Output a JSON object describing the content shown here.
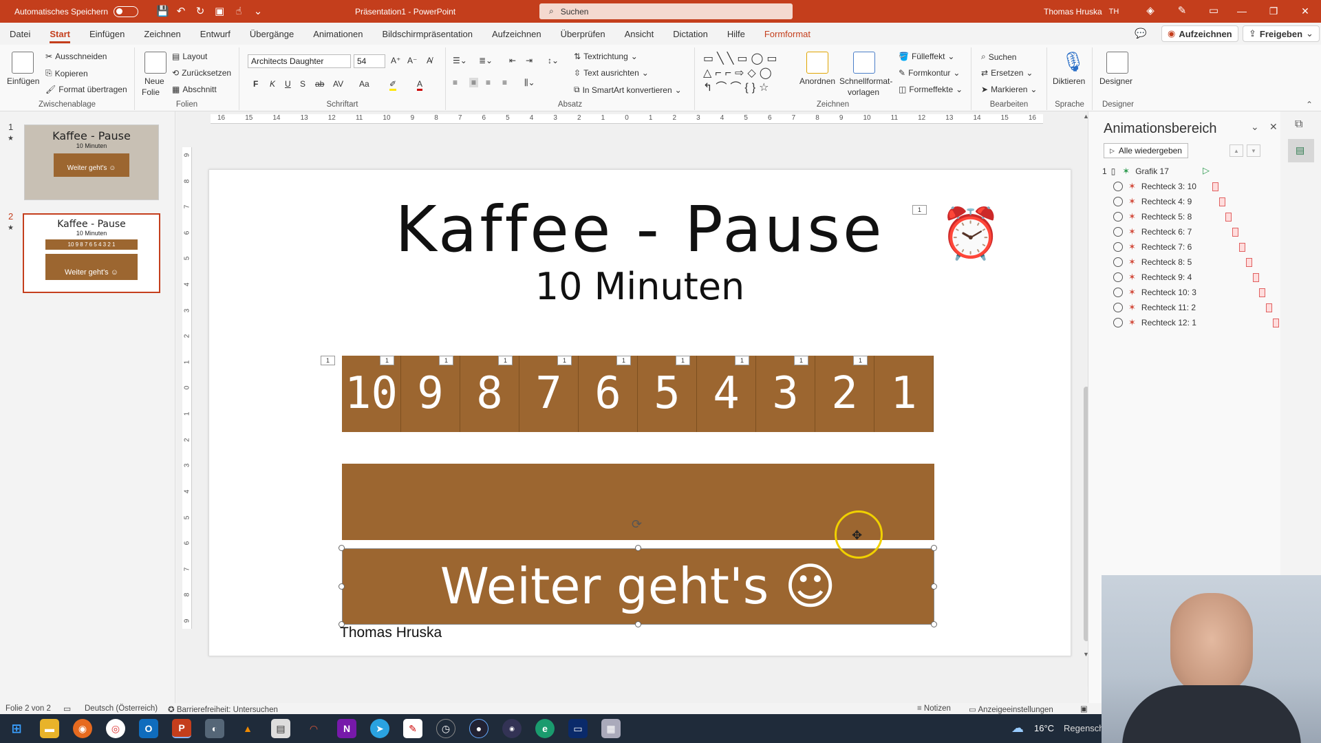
{
  "titlebar": {
    "autosave_label": "Automatisches Speichern",
    "doc_title": "Präsentation1 - PowerPoint",
    "search_placeholder": "Suchen",
    "user_name": "Thomas Hruska",
    "user_initials": "TH"
  },
  "tabs": [
    "Datei",
    "Start",
    "Einfügen",
    "Zeichnen",
    "Entwurf",
    "Übergänge",
    "Animationen",
    "Bildschirmpräsentation",
    "Aufzeichnen",
    "Überprüfen",
    "Ansicht",
    "Dictation",
    "Hilfe",
    "Formformat"
  ],
  "tab_actions": {
    "record": "Aufzeichnen",
    "share": "Freigeben"
  },
  "ribbon": {
    "clipboard": {
      "label": "Zwischenablage",
      "paste": "Einfügen",
      "cut": "Ausschneiden",
      "copy": "Kopieren",
      "format_painter": "Format übertragen"
    },
    "slides": {
      "label": "Folien",
      "new_slide_1": "Neue",
      "new_slide_2": "Folie",
      "layout": "Layout",
      "reset": "Zurücksetzen",
      "section": "Abschnitt"
    },
    "font": {
      "label": "Schriftart",
      "font_name": "Architects Daughter",
      "font_size": "54",
      "bold": "F",
      "italic": "K",
      "underline": "U",
      "shadow": "S",
      "strike": "ab",
      "spacing": "AV",
      "case": "Aa"
    },
    "paragraph": {
      "label": "Absatz",
      "text_direction": "Textrichtung",
      "align_text": "Text ausrichten",
      "smartart": "In SmartArt konvertieren"
    },
    "drawing": {
      "label": "Zeichnen",
      "arrange": "Anordnen",
      "quickstyles_1": "Schnellformat-",
      "quickstyles_2": "vorlagen",
      "fill": "Fülleffekt",
      "outline": "Formkontur",
      "effects": "Formeffekte"
    },
    "editing": {
      "label": "Bearbeiten",
      "find": "Suchen",
      "replace": "Ersetzen",
      "select": "Markieren"
    },
    "voice": {
      "label": "Sprache",
      "dictate": "Diktieren"
    },
    "designer": {
      "label": "Designer",
      "designer": "Designer"
    }
  },
  "ruler_h": [
    "16",
    "15",
    "14",
    "13",
    "12",
    "11",
    "10",
    "9",
    "8",
    "7",
    "6",
    "5",
    "4",
    "3",
    "2",
    "1",
    "0",
    "1",
    "2",
    "3",
    "4",
    "5",
    "6",
    "7",
    "8",
    "9",
    "10",
    "11",
    "12",
    "13",
    "14",
    "15",
    "16"
  ],
  "ruler_v": [
    "9",
    "8",
    "7",
    "6",
    "5",
    "4",
    "3",
    "2",
    "1",
    "0",
    "1",
    "2",
    "3",
    "4",
    "5",
    "6",
    "7",
    "8",
    "9"
  ],
  "slides_panel": [
    {
      "num": "1",
      "title": "Kaffee - Pause",
      "subtitle": "10 Minuten",
      "button": "Weiter geht's ☺"
    },
    {
      "num": "2",
      "title": "Kaffee - Pause",
      "subtitle": "10 Minuten",
      "button": "Weiter geht's ☺",
      "digits": "10 9 8 7 6 5 4 3 2 1"
    }
  ],
  "slide": {
    "title": "Kaffee - Pause",
    "subtitle": "10 Minuten",
    "countdown": [
      "10",
      "9",
      "8",
      "7",
      "6",
      "5",
      "4",
      "3",
      "2",
      "1"
    ],
    "button_text": "Weiter geht's ☺",
    "footer": "Thomas Hruska",
    "tags": [
      "1",
      "1",
      "1",
      "1",
      "1",
      "1",
      "1",
      "1",
      "1",
      "1"
    ],
    "clock_tag": "1",
    "box_color": "#9c6630"
  },
  "anim_pane": {
    "title": "Animationsbereich",
    "play_all": "Alle wiedergeben",
    "first_index": "1",
    "items": [
      "Grafik 17",
      "Rechteck 3: 10",
      "Rechteck 4: 9",
      "Rechteck 5: 8",
      "Rechteck 6: 7",
      "Rechteck 7: 6",
      "Rechteck 8: 5",
      "Rechteck 9: 4",
      "Rechteck 10: 3",
      "Rechteck 11: 2",
      "Rechteck 12: 1"
    ]
  },
  "statusbar": {
    "slide_info": "Folie 2 von 2",
    "language": "Deutsch (Österreich)",
    "accessibility": "Barrierefreiheit: Untersuchen",
    "notes": "Notizen",
    "display": "Anzeigeeinstellungen"
  },
  "taskbar": {
    "weather_temp": "16°C",
    "weather_text": "Regenscha"
  }
}
